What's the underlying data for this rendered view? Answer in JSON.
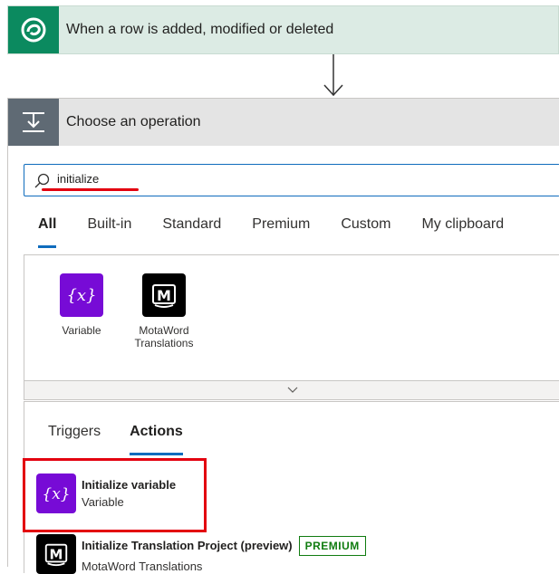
{
  "trigger": {
    "title": "When a row is added, modified or deleted",
    "icon": "dataverse-icon",
    "color": "#0b8a5f"
  },
  "operation": {
    "title": "Choose an operation",
    "icon": "action-icon",
    "search": {
      "value": "initialize",
      "placeholder": "Search connectors and actions"
    },
    "tabs": [
      {
        "label": "All",
        "active": true
      },
      {
        "label": "Built-in"
      },
      {
        "label": "Standard"
      },
      {
        "label": "Premium"
      },
      {
        "label": "Custom"
      },
      {
        "label": "My clipboard"
      }
    ],
    "connectors": [
      {
        "label": "Variable",
        "icon": "variable-icon",
        "color": "#770bd6"
      },
      {
        "label": "MotaWord Translations",
        "icon": "motaword-icon",
        "color": "#000000"
      }
    ],
    "expand_icon": "chevron-down-icon",
    "subtabs": [
      {
        "label": "Triggers"
      },
      {
        "label": "Actions",
        "active": true
      }
    ],
    "actions": [
      {
        "name": "Initialize variable",
        "connector": "Variable",
        "icon": "variable-icon",
        "color": "#770bd6"
      },
      {
        "name": "Initialize Translation Project (preview)",
        "connector": "MotaWord Translations",
        "badge": "PREMIUM",
        "icon": "motaword-icon",
        "color": "#000000"
      }
    ]
  },
  "colors": {
    "accent": "#0f6cbd",
    "highlight": "#e3000f",
    "premium": "#107c10"
  }
}
